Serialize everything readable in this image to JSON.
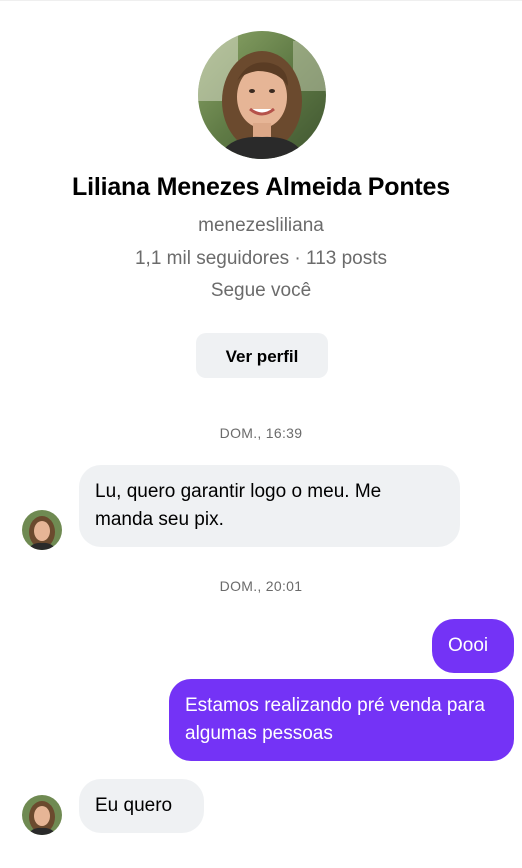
{
  "profile": {
    "name": "Liliana Menezes Almeida Pontes",
    "username": "menezesliliana",
    "stats": "1,1 mil seguidores · 113 posts",
    "follows_you": "Segue você",
    "view_profile_label": "Ver perfil"
  },
  "conversation": {
    "timestamps": [
      "DOM., 16:39",
      "DOM., 20:01"
    ],
    "messages": [
      {
        "direction": "incoming",
        "text": "Lu, quero garantir logo o meu. Me manda seu pix."
      },
      {
        "direction": "outgoing",
        "text": "Oooi"
      },
      {
        "direction": "outgoing",
        "text": "Estamos realizando pré venda para algumas pessoas"
      },
      {
        "direction": "incoming",
        "text": "Eu quero"
      }
    ]
  },
  "colors": {
    "outgoing_bubble": "#7433f6",
    "incoming_bubble": "#eff1f3",
    "secondary_text": "#6b6b6b"
  }
}
